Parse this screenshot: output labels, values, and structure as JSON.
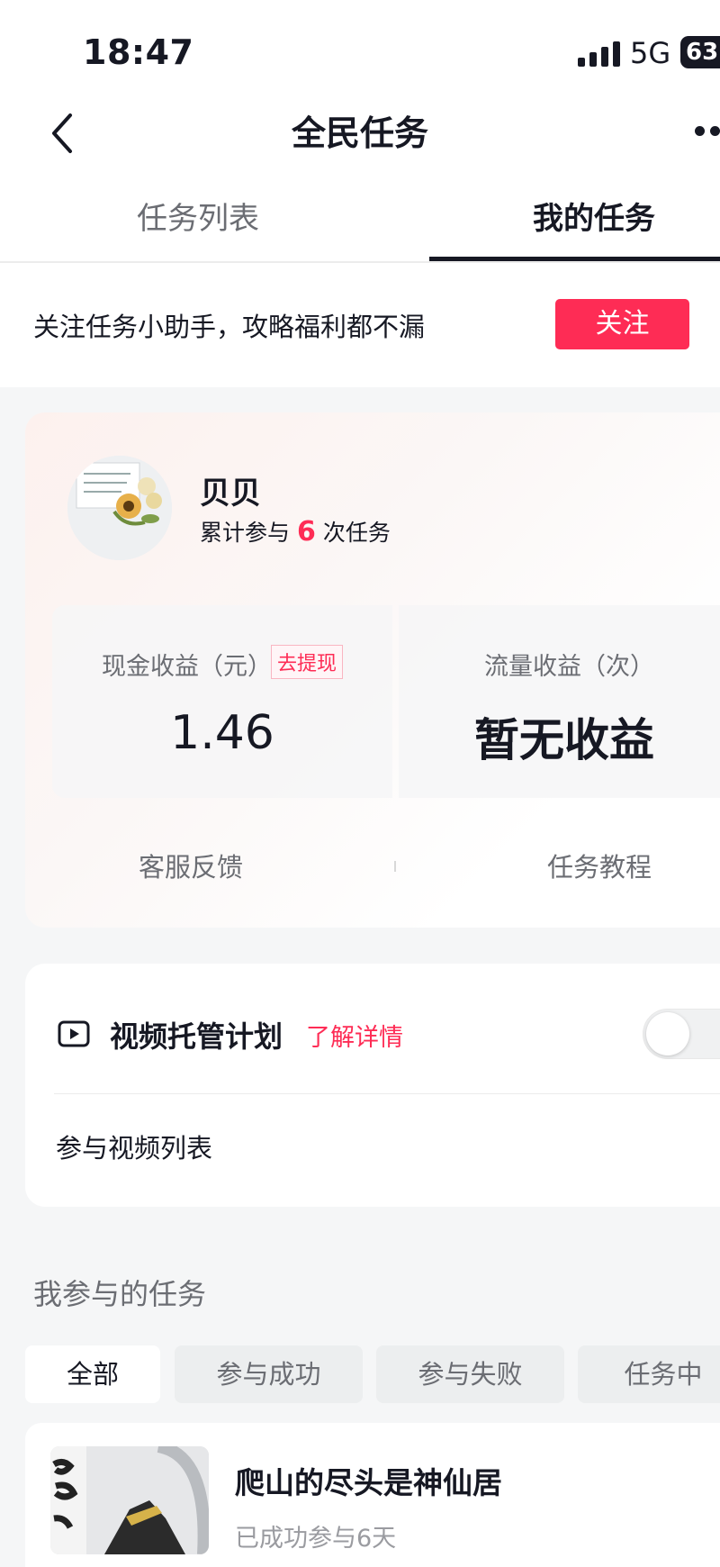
{
  "status_bar": {
    "time": "18:47",
    "network": "5G",
    "battery": "63"
  },
  "nav": {
    "title": "全民任务",
    "back_icon": "chevron-left-icon",
    "more_icon": "more-dots-icon"
  },
  "tabs": [
    {
      "label": "任务列表",
      "active": false
    },
    {
      "label": "我的任务",
      "active": true
    }
  ],
  "follow_banner": {
    "text": "关注任务小助手，攻略福利都不漏",
    "button": "关注"
  },
  "profile": {
    "name": "贝贝",
    "participation_prefix": "累计参与",
    "participation_count": "6",
    "participation_suffix": "次任务",
    "cash_label": "现金收益（元）",
    "withdraw_label": "去提现",
    "cash_value": "1.46",
    "flow_label": "流量收益（次）",
    "flow_value": "暂无收益",
    "links": [
      "客服反馈",
      "任务教程"
    ]
  },
  "video_plan": {
    "title": "视频托管计划",
    "learn_more": "了解详情",
    "toggle_on": false,
    "list_label": "参与视频列表"
  },
  "my_tasks": {
    "section_title": "我参与的任务",
    "filters": [
      {
        "label": "全部",
        "active": true
      },
      {
        "label": "参与成功",
        "active": false
      },
      {
        "label": "参与失败",
        "active": false
      },
      {
        "label": "任务中",
        "active": false
      }
    ],
    "items": [
      {
        "title": "爬山的尽头是神仙居",
        "subtitle": "已成功参与6天"
      }
    ]
  },
  "colors": {
    "accent": "#fe2c55",
    "text": "#161823",
    "muted": "#6b6d73",
    "background": "#f5f6f7"
  }
}
